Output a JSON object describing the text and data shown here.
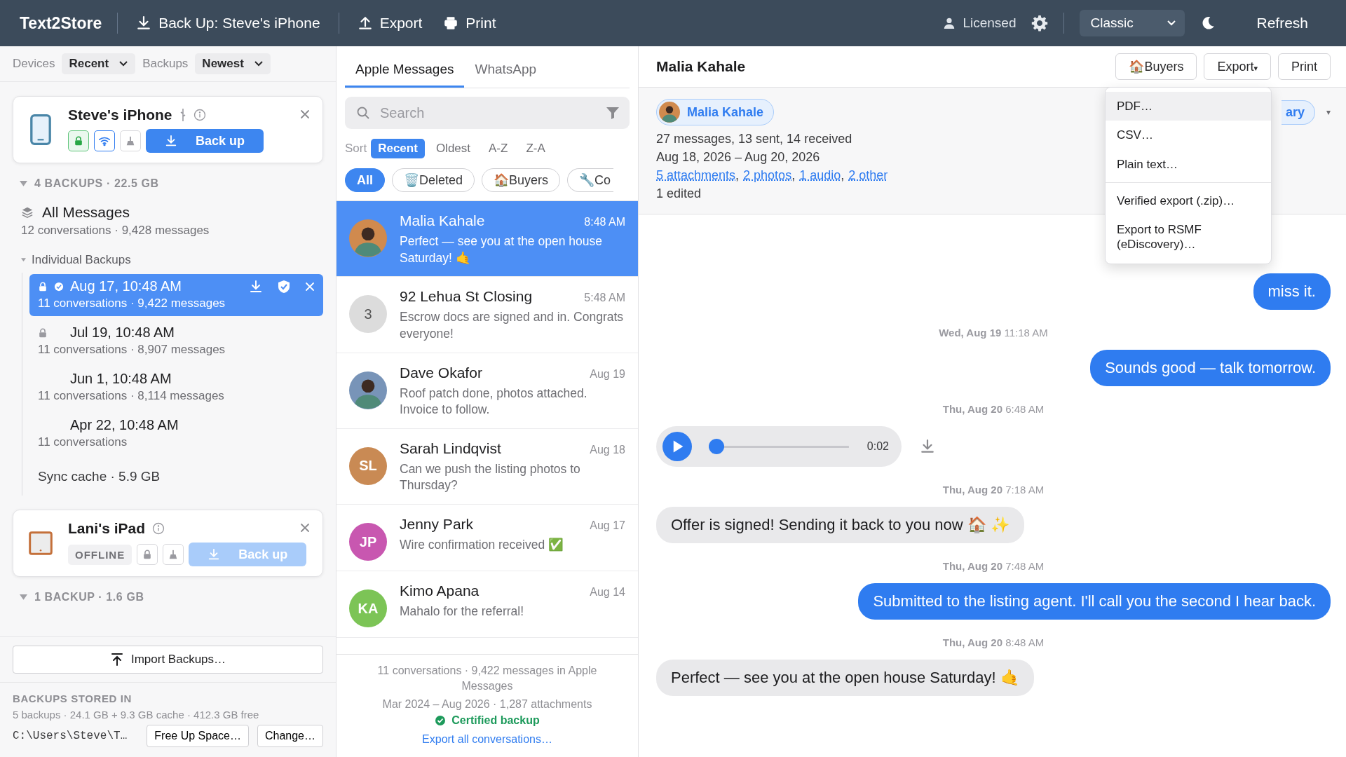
{
  "toolbar": {
    "app_name": "Text2Store",
    "actions": [
      {
        "label": "Back Up: Steve's iPhone"
      },
      {
        "label": "Export"
      },
      {
        "label": "Print"
      }
    ],
    "license": "Licensed",
    "theme": "Classic",
    "refresh": "Refresh"
  },
  "sidebar": {
    "filters": [
      {
        "label": "Devices",
        "value": "Recent"
      },
      {
        "label": "Backups",
        "value": "Newest"
      }
    ],
    "devices": [
      {
        "kind": "phone",
        "name": "Steve's iPhone",
        "usb": true,
        "locked": true,
        "wifi": true,
        "button": {
          "label": "Back up",
          "disabled": false
        },
        "summary": "4 BACKUPS · 22.5 GB",
        "expanded": true,
        "all_messages": {
          "title": "All Messages",
          "subtitle": "12 conversations · 9,428 messages"
        },
        "group": {
          "label": "Individual Backups",
          "expanded": true,
          "items": [
            {
              "date": "Aug 17, 10:48 AM",
              "subtitle": "11 conversations · 9,422 messages",
              "selected": true,
              "locked": true,
              "verified": true
            },
            {
              "date": "Jul 19, 10:48 AM",
              "subtitle": "11 conversations · 8,907 messages",
              "selected": false,
              "locked": true,
              "verified": false
            },
            {
              "date": "Jun 1, 10:48 AM",
              "subtitle": "11 conversations · 8,114 messages",
              "selected": false,
              "locked": false,
              "verified": false
            },
            {
              "date": "Apr 22, 10:48 AM",
              "subtitle": "11 conversations",
              "selected": false,
              "locked": false,
              "verified": false
            }
          ]
        },
        "sync_cache": "Sync cache · 5.9 GB"
      },
      {
        "kind": "tablet",
        "name": "Lani's iPad",
        "usb": false,
        "status": "OFFLINE",
        "locked": false,
        "wifi": false,
        "button": {
          "label": "Back up",
          "disabled": true
        },
        "summary": "1 BACKUP · 1.6 GB",
        "expanded": true
      }
    ],
    "import_button": "Import Backups…",
    "storage": {
      "heading": "BACKUPS STORED IN",
      "details": "5 backups · 24.1 GB + 9.3 GB cache · 412.3 GB free",
      "path": "C:\\Users\\Steve\\T…",
      "buttons": [
        "Free Up Space…",
        "Change…"
      ]
    }
  },
  "conversations": {
    "tabs": [
      {
        "label": "Apple Messages",
        "selected": true
      },
      {
        "label": "WhatsApp",
        "selected": false
      }
    ],
    "search": {
      "placeholder": "Search"
    },
    "sort": {
      "label": "Sort",
      "options": [
        {
          "label": "Recent",
          "selected": true
        },
        {
          "label": "Oldest",
          "selected": false
        },
        {
          "label": "A-Z",
          "selected": false
        },
        {
          "label": "Z-A",
          "selected": false
        }
      ]
    },
    "chips": [
      {
        "label": "All",
        "selected": true
      },
      {
        "label": "Deleted",
        "emoji": "🗑️",
        "selected": false
      },
      {
        "label": "Buyers",
        "emoji": "🏠",
        "selected": false
      },
      {
        "label": "Co",
        "emoji": "🔧",
        "selected": false
      }
    ],
    "items": [
      {
        "name": "Malia Kahale",
        "time": "8:48 AM",
        "preview": "Perfect — see you at the open house Saturday! 🤙",
        "avatar": {
          "kind": "photo",
          "color": "#d08a4e"
        },
        "selected": true
      },
      {
        "name": "92 Lehua St Closing",
        "time": "5:48 AM",
        "preview": "Escrow docs are signed and in. Congrats everyone!",
        "avatar": {
          "kind": "count",
          "text": "3",
          "color": "#dcdcdc"
        },
        "selected": false
      },
      {
        "name": "Dave Okafor",
        "time": "Aug 19",
        "preview": "Roof patch done, photos attached. Invoice to follow.",
        "avatar": {
          "kind": "photo",
          "color": "#7894b8"
        },
        "selected": false
      },
      {
        "name": "Sarah Lindqvist",
        "time": "Aug 18",
        "preview": "Can we push the listing photos to Thursday?",
        "avatar": {
          "kind": "initials",
          "text": "SL",
          "color": "#c98a54"
        },
        "selected": false
      },
      {
        "name": "Jenny Park",
        "time": "Aug 17",
        "preview": "Wire confirmation received ✅",
        "avatar": {
          "kind": "initials",
          "text": "JP",
          "color": "#c857b0"
        },
        "selected": false
      },
      {
        "name": "Kimo Apana",
        "time": "Aug 14",
        "preview": "Mahalo for the referral!",
        "avatar": {
          "kind": "initials",
          "text": "KA",
          "color": "#7cc456"
        },
        "selected": false
      }
    ],
    "footer": {
      "lines": [
        "11 conversations · 9,422 messages in Apple Messages",
        "Mar 2024 – Aug 2026 · 1,287 attachments"
      ],
      "certified": "Certified backup",
      "link": "Export all conversations…"
    }
  },
  "chat": {
    "title": "Malia Kahale",
    "buttons": [
      {
        "label": "Buyers",
        "emoji": "🏠"
      },
      {
        "label": "Export",
        "caret": "▾"
      },
      {
        "label": "Print"
      }
    ],
    "info": {
      "contact": "Malia Kahale",
      "lines": [
        "27 messages, 13 sent, 14 received",
        "Aug 18, 2026 – Aug 20, 2026"
      ],
      "links": [
        "5 attachments",
        "2 photos",
        "1 audio",
        "2 other"
      ],
      "separator": ",",
      "edited": "1 edited",
      "partial_button": "ary",
      "caret": "▾"
    },
    "menu": {
      "groups": [
        [
          {
            "label": "PDF…",
            "selected": true
          },
          {
            "label": "CSV…",
            "selected": false
          },
          {
            "label": "Plain text…",
            "selected": false
          }
        ],
        [
          {
            "label": "Verified export (.zip)…",
            "selected": false
          },
          {
            "label": "Export to RSMF (eDiscovery)…",
            "selected": false
          }
        ]
      ]
    },
    "messages": [
      {
        "kind": "sent",
        "text": "miss it."
      },
      {
        "kind": "timestamp",
        "text": "**Wed, Aug 19** 11:18 AM"
      },
      {
        "kind": "sent",
        "text": "Sounds good — talk tomorrow."
      },
      {
        "kind": "timestamp",
        "text": "**Thu, Aug 20** 6:48 AM"
      },
      {
        "kind": "audio",
        "duration": "0:02",
        "level": 0
      },
      {
        "kind": "timestamp",
        "text": "**Thu, Aug 20** 7:18 AM"
      },
      {
        "kind": "received",
        "text": "Offer is signed! Sending it back to you now 🏠 ✨"
      },
      {
        "kind": "timestamp",
        "text": "**Thu, Aug 20** 7:48 AM"
      },
      {
        "kind": "sent",
        "text": "Submitted to the listing agent. I'll call you the second I hear back."
      },
      {
        "kind": "timestamp",
        "text": "**Thu, Aug 20** 8:48 AM"
      },
      {
        "kind": "received",
        "text": "Perfect — see you at the open house Saturday! 🤙"
      }
    ]
  }
}
